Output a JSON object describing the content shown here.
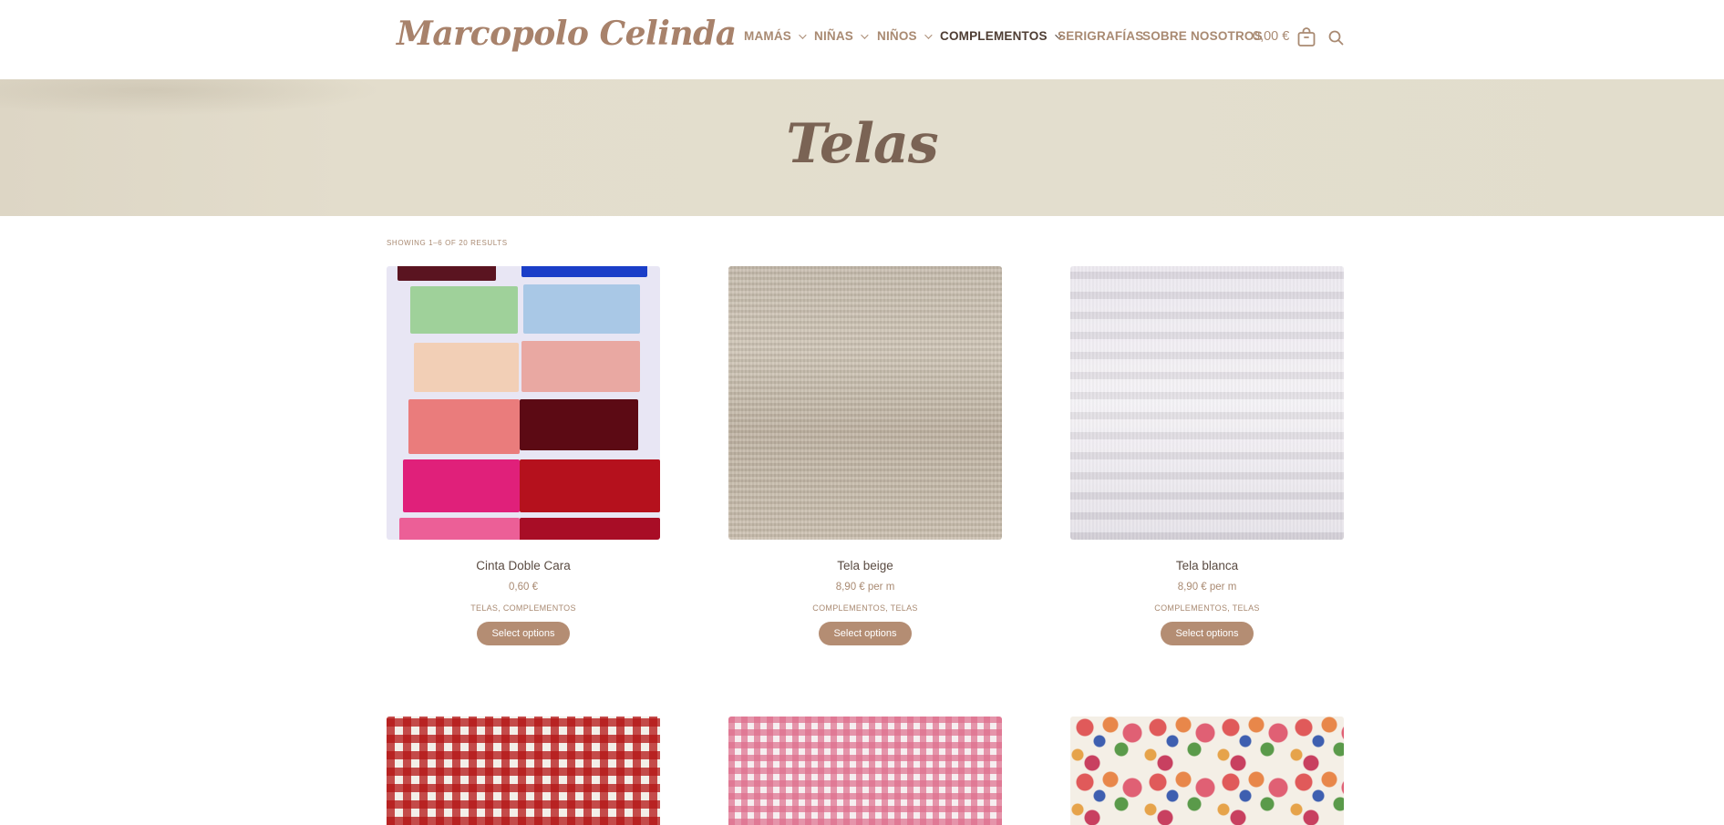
{
  "header": {
    "logo": "Marcopolo Celinda",
    "nav": [
      {
        "label": "MAMÁS",
        "has_dropdown": true,
        "active": false
      },
      {
        "label": "NIÑAS",
        "has_dropdown": true,
        "active": false
      },
      {
        "label": "NIÑOS",
        "has_dropdown": true,
        "active": false
      },
      {
        "label": "COMPLEMENTOS",
        "has_dropdown": true,
        "active": true
      },
      {
        "label": "SERIGRAFÍAS",
        "has_dropdown": false,
        "active": false
      },
      {
        "label": "SOBRE NOSOTROS",
        "has_dropdown": false,
        "active": false
      }
    ],
    "cart_total": "0,00 €",
    "cart_icon": "shopping-bag-icon",
    "search_icon": "search-icon"
  },
  "hero": {
    "title": "Telas"
  },
  "results_text": "Showing 1–6 of 20 results",
  "products": [
    {
      "name": "Cinta Doble Cara",
      "price": "0,60 €",
      "categories": "TELAS, COMPLEMENTOS",
      "button": "Select options"
    },
    {
      "name": "Tela beige",
      "price": "8,90 € per m",
      "categories": "COMPLEMENTOS, TELAS",
      "button": "Select options"
    },
    {
      "name": "Tela blanca",
      "price": "8,90 € per m",
      "categories": "COMPLEMENTOS, TELAS",
      "button": "Select options"
    }
  ],
  "colors": {
    "brand": "#a8826b",
    "button": "#b48d73",
    "hero_bg": "#e3ddcc",
    "active_nav": "#4e3d33"
  }
}
